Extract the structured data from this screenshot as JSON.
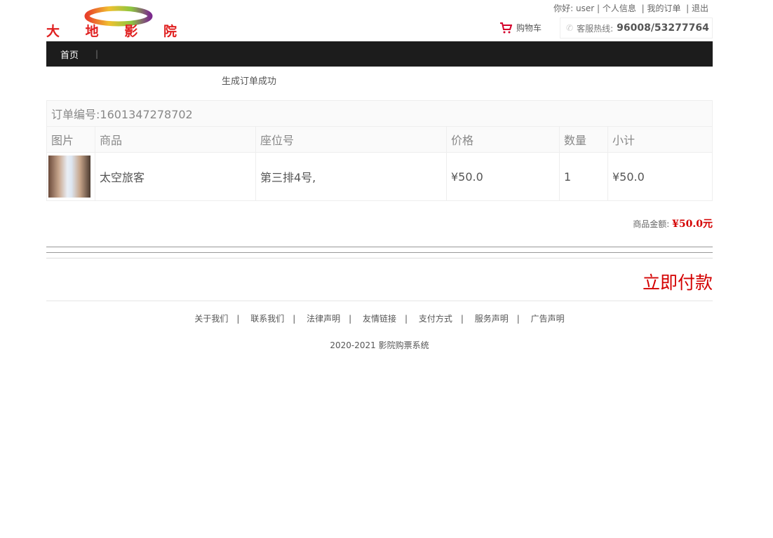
{
  "logo": {
    "text": "大地影院"
  },
  "topbar": {
    "greeting": "你好:",
    "user": "user",
    "sep": "|",
    "profile": "个人信息",
    "orders": "我的订单",
    "logout": "退出"
  },
  "cart": {
    "label": "购物车"
  },
  "hotline": {
    "label": "客服热线:",
    "number": "96008/53277764"
  },
  "nav": {
    "home": "首页",
    "sep": "|"
  },
  "message": "生成订单成功",
  "order": {
    "number_label": "订单编号:1601347278702",
    "columns": [
      "图片",
      "商品",
      "座位号",
      "价格",
      "数量",
      "小计"
    ],
    "items": [
      {
        "name": "太空旅客",
        "seat": "第三排4号,",
        "price": "¥50.0",
        "qty": "1",
        "subtotal": "¥50.0"
      }
    ]
  },
  "total": {
    "label": "商品金额:",
    "value": "¥50.0元"
  },
  "pay_label": "立即付款",
  "footer": {
    "links": [
      "关于我们",
      "联系我们",
      "法律声明",
      "友情链接",
      "支付方式",
      "服务声明",
      "广告声明"
    ],
    "sep": "|",
    "copyright": "2020-2021 影院购票系统"
  },
  "colors": {
    "accent": "#d40000",
    "nav_bg": "#1c1c1c"
  }
}
